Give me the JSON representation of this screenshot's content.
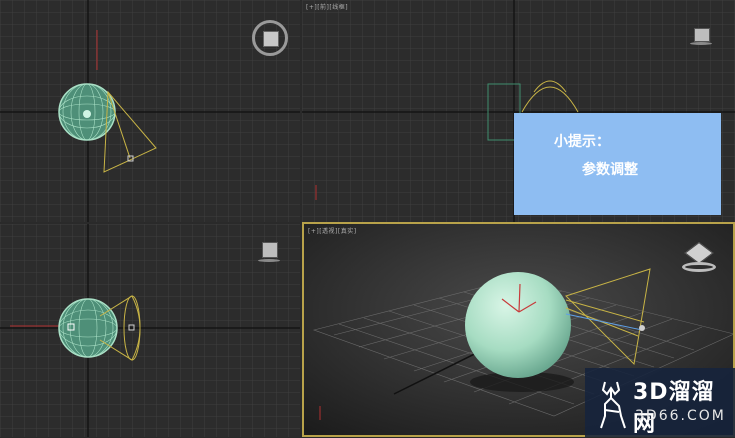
{
  "viewports": {
    "top": {
      "label": ""
    },
    "front": {
      "label": "[+][前][线框]"
    },
    "left": {
      "label": ""
    },
    "perspective": {
      "label": "[+][透视][真实]"
    }
  },
  "tip": {
    "title": "小提示：",
    "body": "参数调整",
    "background": "#8ebdf2"
  },
  "watermark": {
    "brand": "3D溜溜网",
    "url": "3D66.COM"
  },
  "colors": {
    "grid": "#3b3b3b",
    "grid_major": "#1f1f1f",
    "sphere": "#a9e0c6",
    "light_cone": "#c8b446",
    "active_border": "#b8a24a"
  },
  "icons": {
    "viewcube": "viewcube-icon",
    "deer": "deer-logo-icon"
  }
}
